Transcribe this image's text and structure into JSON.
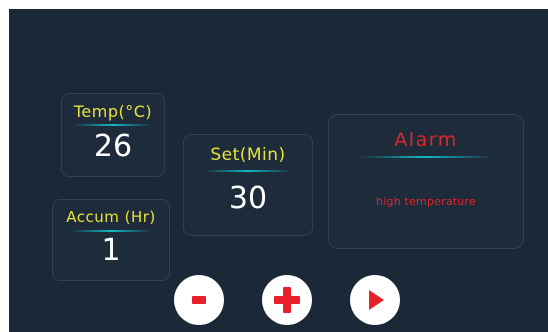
{
  "temp": {
    "label": "Temp(°C)",
    "value": "26"
  },
  "accum": {
    "label": "Accum (Hr)",
    "value": "1"
  },
  "set": {
    "label": "Set(Min)",
    "value": "30"
  },
  "alarm": {
    "title": "Alarm",
    "message": "high temperature"
  },
  "buttons": {
    "decrease_icon": "minus-icon",
    "increase_icon": "plus-icon",
    "start_icon": "play-icon"
  },
  "colors": {
    "background": "#1b2838",
    "label": "#e8e33a",
    "value": "#ffffff",
    "alarm": "#e0262b",
    "divider": "#13b9c4",
    "button_icon": "#e8202a"
  }
}
